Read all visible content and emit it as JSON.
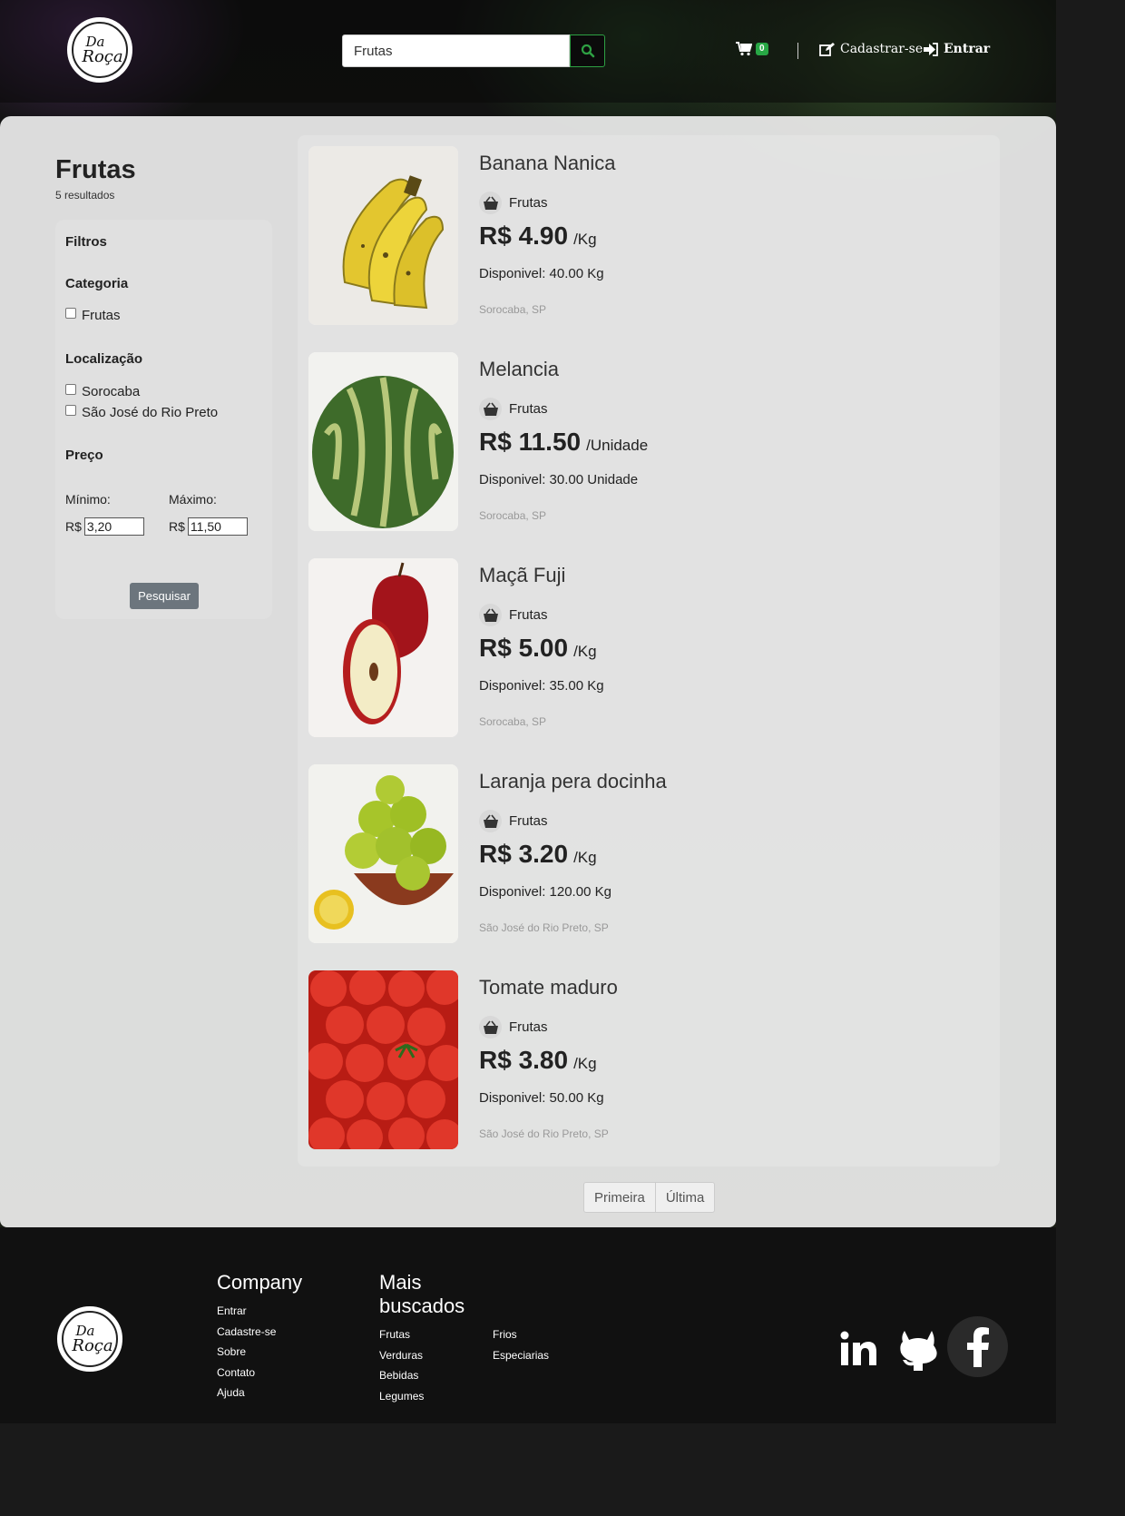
{
  "header": {
    "logo_line1": "Da",
    "logo_line2": "Roça",
    "search": {
      "value": "Frutas",
      "placeholder": ""
    },
    "cart_count": "0",
    "signup_label": "Cadastrar-se",
    "login_label": "Entrar"
  },
  "results": {
    "title": "Frutas",
    "count": "5 resultados"
  },
  "filters": {
    "title": "Filtros",
    "category_title": "Categoria",
    "categories": [
      "Frutas"
    ],
    "location_title": "Localização",
    "locations": [
      "Sorocaba",
      "São José do Rio Preto"
    ],
    "price_title": "Preço",
    "min_label": "Mínimo:",
    "max_label": "Máximo:",
    "currency": "R$",
    "min_value": "3,20",
    "max_value": "11,50",
    "search_button": "Pesquisar"
  },
  "products": [
    {
      "name": "Banana Nanica",
      "category": "Frutas",
      "price": "R$ 4.90",
      "unit": "/Kg",
      "stock": "Disponivel: 40.00 Kg",
      "location": "Sorocaba, SP",
      "image": "banana"
    },
    {
      "name": "Melancia",
      "category": "Frutas",
      "price": "R$ 11.50",
      "unit": "/Unidade",
      "stock": "Disponivel: 30.00 Unidade",
      "location": "Sorocaba, SP",
      "image": "watermelon"
    },
    {
      "name": "Maçã Fuji",
      "category": "Frutas",
      "price": "R$ 5.00",
      "unit": "/Kg",
      "stock": "Disponivel: 35.00 Kg",
      "location": "Sorocaba, SP",
      "image": "apple"
    },
    {
      "name": "Laranja pera docinha",
      "category": "Frutas",
      "price": "R$ 3.20",
      "unit": "/Kg",
      "stock": "Disponivel: 120.00 Kg",
      "location": "São José do Rio Preto, SP",
      "image": "orange"
    },
    {
      "name": "Tomate maduro",
      "category": "Frutas",
      "price": "R$ 3.80",
      "unit": "/Kg",
      "stock": "Disponivel: 50.00 Kg",
      "location": "São José do Rio Preto, SP",
      "image": "tomato"
    }
  ],
  "pagination": {
    "first": "Primeira",
    "last": "Última"
  },
  "footer": {
    "company_title": "Company",
    "company_links": [
      "Entrar",
      "Cadastre-se",
      "Sobre",
      "Contato",
      "Ajuda"
    ],
    "popular_title_1": "Mais",
    "popular_title_2": "buscados",
    "popular_col1": [
      "Frutas",
      "Verduras",
      "Bebidas",
      "Legumes"
    ],
    "popular_col2": [
      "Frios",
      "Especiarias"
    ],
    "social": [
      "linkedin-icon",
      "github-icon",
      "facebook-icon"
    ]
  },
  "colors": {
    "accent": "#28a745",
    "dark": "#111111",
    "panel": "#ececec"
  }
}
